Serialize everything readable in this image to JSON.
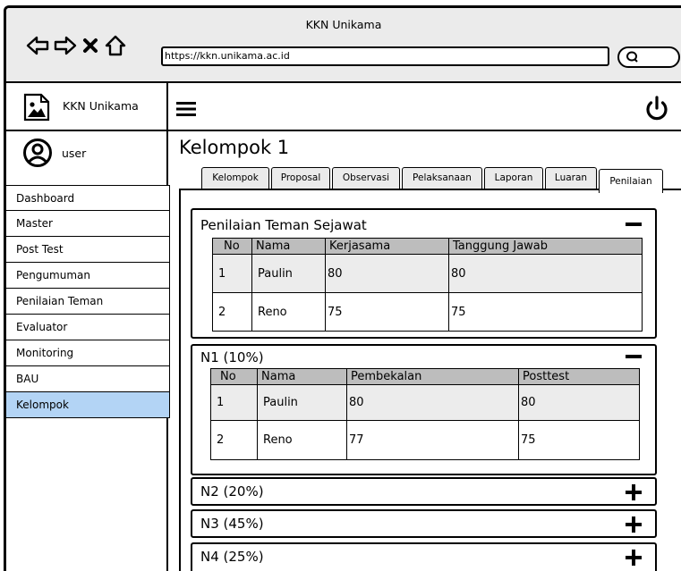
{
  "browser": {
    "title": "KKN Unikama",
    "url": "https://kkn.unikama.ac.id"
  },
  "brand": {
    "label": "KKN Unikama",
    "logo_icon": "image-icon"
  },
  "header": {
    "menu_icon": "hamburger-icon",
    "power_icon": "power-icon"
  },
  "user": {
    "name": "user",
    "avatar_icon": "user-circle-icon"
  },
  "sidebar": {
    "items": [
      {
        "label": "Dashboard"
      },
      {
        "label": "Master"
      },
      {
        "label": "Post Test"
      },
      {
        "label": "Pengumuman"
      },
      {
        "label": "Penilaian Teman"
      },
      {
        "label": "Evaluator"
      },
      {
        "label": "Monitoring"
      },
      {
        "label": "BAU"
      },
      {
        "label": "Kelompok"
      }
    ],
    "active": "Kelompok",
    "active_color": "#b3d4f5"
  },
  "page": {
    "title": "Kelompok 1"
  },
  "tabs": [
    {
      "label": "Kelompok"
    },
    {
      "label": "Proposal"
    },
    {
      "label": "Observasi"
    },
    {
      "label": "Pelaksanaan"
    },
    {
      "label": "Laporan"
    },
    {
      "label": "Luaran"
    },
    {
      "label": "Penilaian"
    }
  ],
  "active_tab": "Penilaian",
  "panels": {
    "peer": {
      "title": "Penilaian Teman Sejawat",
      "toggle": "−",
      "columns": [
        "No",
        "Nama",
        "Kerjasama",
        "Tanggung Jawab"
      ],
      "rows": [
        [
          "1",
          "Paulin",
          "80",
          "80"
        ],
        [
          "2",
          "Reno",
          "75",
          "75"
        ]
      ]
    },
    "n1": {
      "title": "N1 (10%)",
      "toggle": "−",
      "columns": [
        "No",
        "Nama",
        "Pembekalan",
        "Posttest"
      ],
      "rows": [
        [
          "1",
          "Paulin",
          "80",
          "80"
        ],
        [
          "2",
          "Reno",
          "77",
          "75"
        ]
      ]
    },
    "n2": {
      "title": "N2 (20%)",
      "toggle": "+"
    },
    "n3": {
      "title": "N3 (45%)",
      "toggle": "+"
    },
    "n4": {
      "title": "N4 (25%)",
      "toggle": "+"
    }
  }
}
